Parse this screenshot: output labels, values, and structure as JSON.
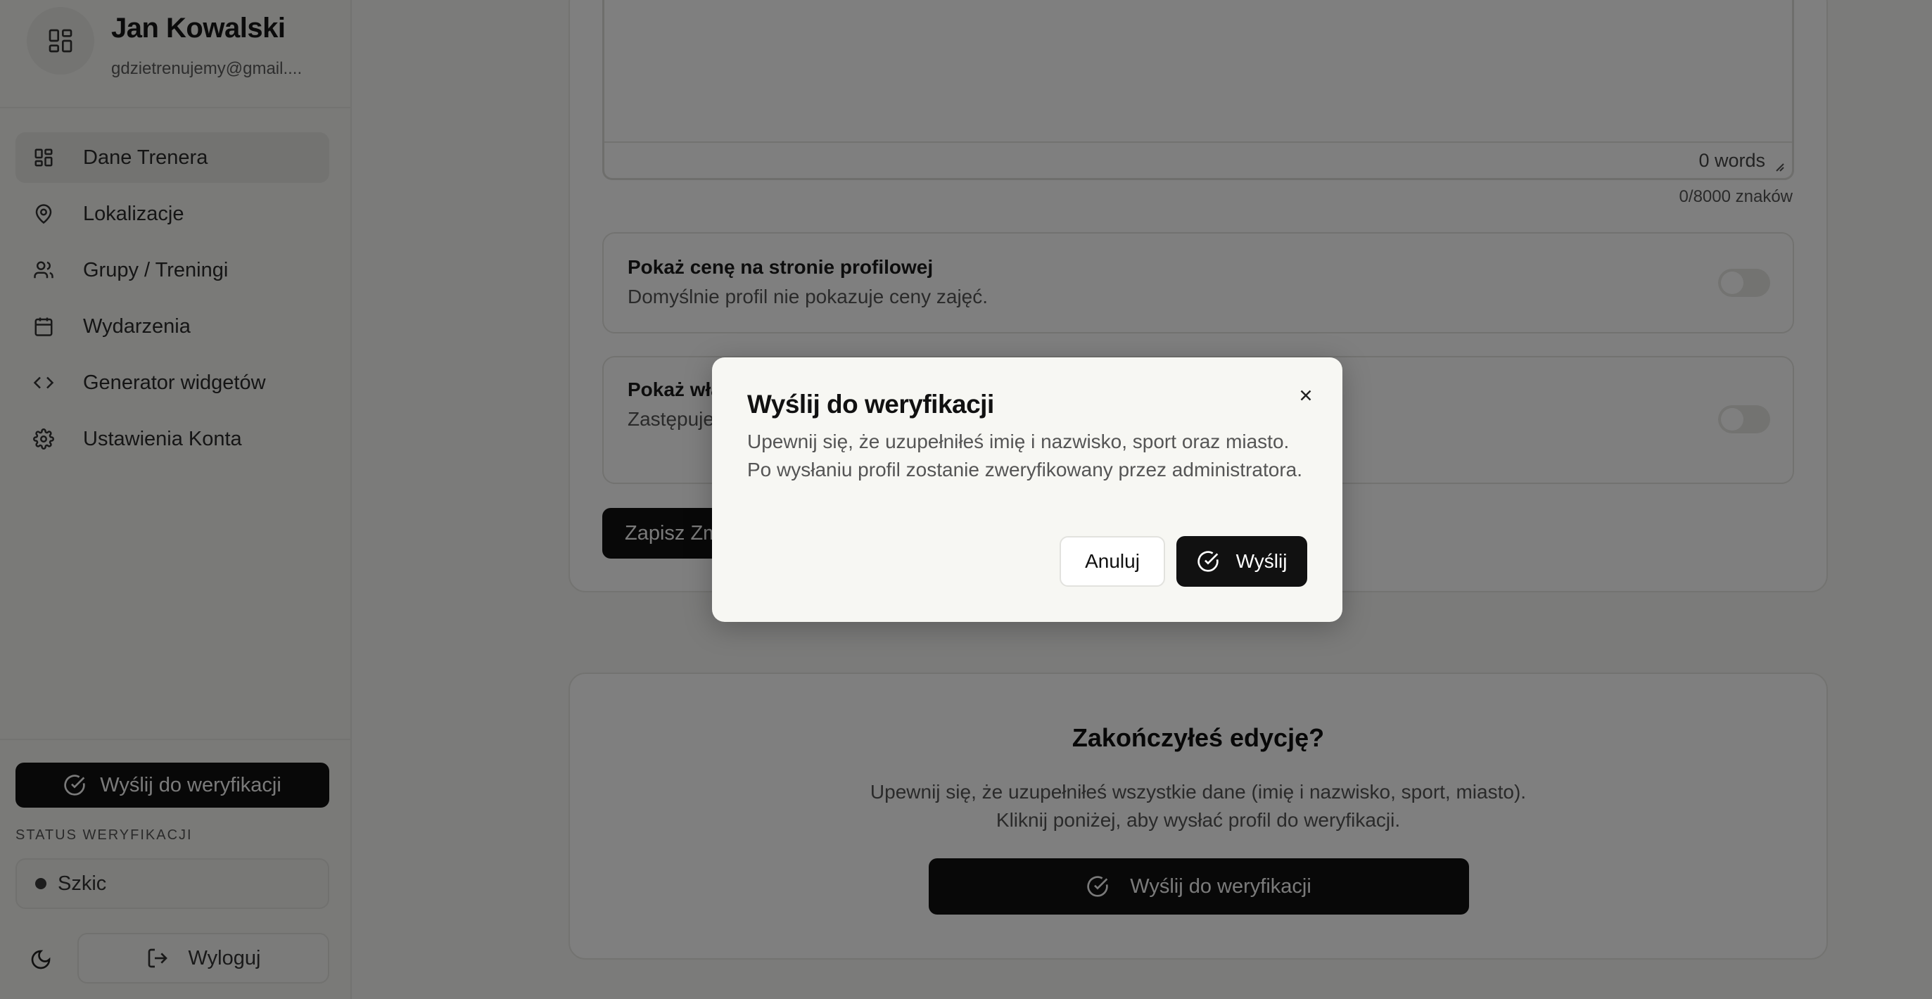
{
  "user": {
    "name": "Jan Kowalski",
    "email": "gdzietrenujemy@gmail...."
  },
  "sidebar": {
    "items": [
      {
        "label": "Dane Trenera",
        "icon": "dashboard-icon",
        "active": true
      },
      {
        "label": "Lokalizacje",
        "icon": "map-pin-icon"
      },
      {
        "label": "Grupy / Treningi",
        "icon": "users-icon"
      },
      {
        "label": "Wydarzenia",
        "icon": "calendar-icon"
      },
      {
        "label": "Generator widgetów",
        "icon": "code-icon"
      },
      {
        "label": "Ustawienia Konta",
        "icon": "settings-icon"
      }
    ],
    "verify_button": "Wyślij do weryfikacji",
    "status_label": "STATUS WERYFIKACJI",
    "status_value": "Szkic",
    "logout": "Wyloguj"
  },
  "editor": {
    "word_count": "0 words",
    "char_count": "0/8000 znaków"
  },
  "toggles": [
    {
      "title": "Pokaż cenę na stronie profilowej",
      "description": "Domyślnie profil nie pokazuje ceny zajęć.",
      "enabled": false
    },
    {
      "title": "Pokaż wła",
      "description": "Zastępuje                                                                                                        ytania bez odpowiedzi nie pokażą się na profilu",
      "enabled": false
    }
  ],
  "save_button": "Zapisz Zm",
  "finish_card": {
    "title": "Zakończyłeś edycję?",
    "line1": "Upewnij się, że uzupełniłeś wszystkie dane (imię i nazwisko, sport, miasto).",
    "line2": "Kliknij poniżej, aby wysłać profil do weryfikacji.",
    "button": "Wyślij do weryfikacji"
  },
  "modal": {
    "title": "Wyślij do weryfikacji",
    "description": "Upewnij się, że uzupełniłeś imię i nazwisko, sport oraz miasto. Po wysłaniu profil zostanie zweryfikowany przez administratora.",
    "cancel": "Anuluj",
    "confirm": "Wyślij"
  }
}
